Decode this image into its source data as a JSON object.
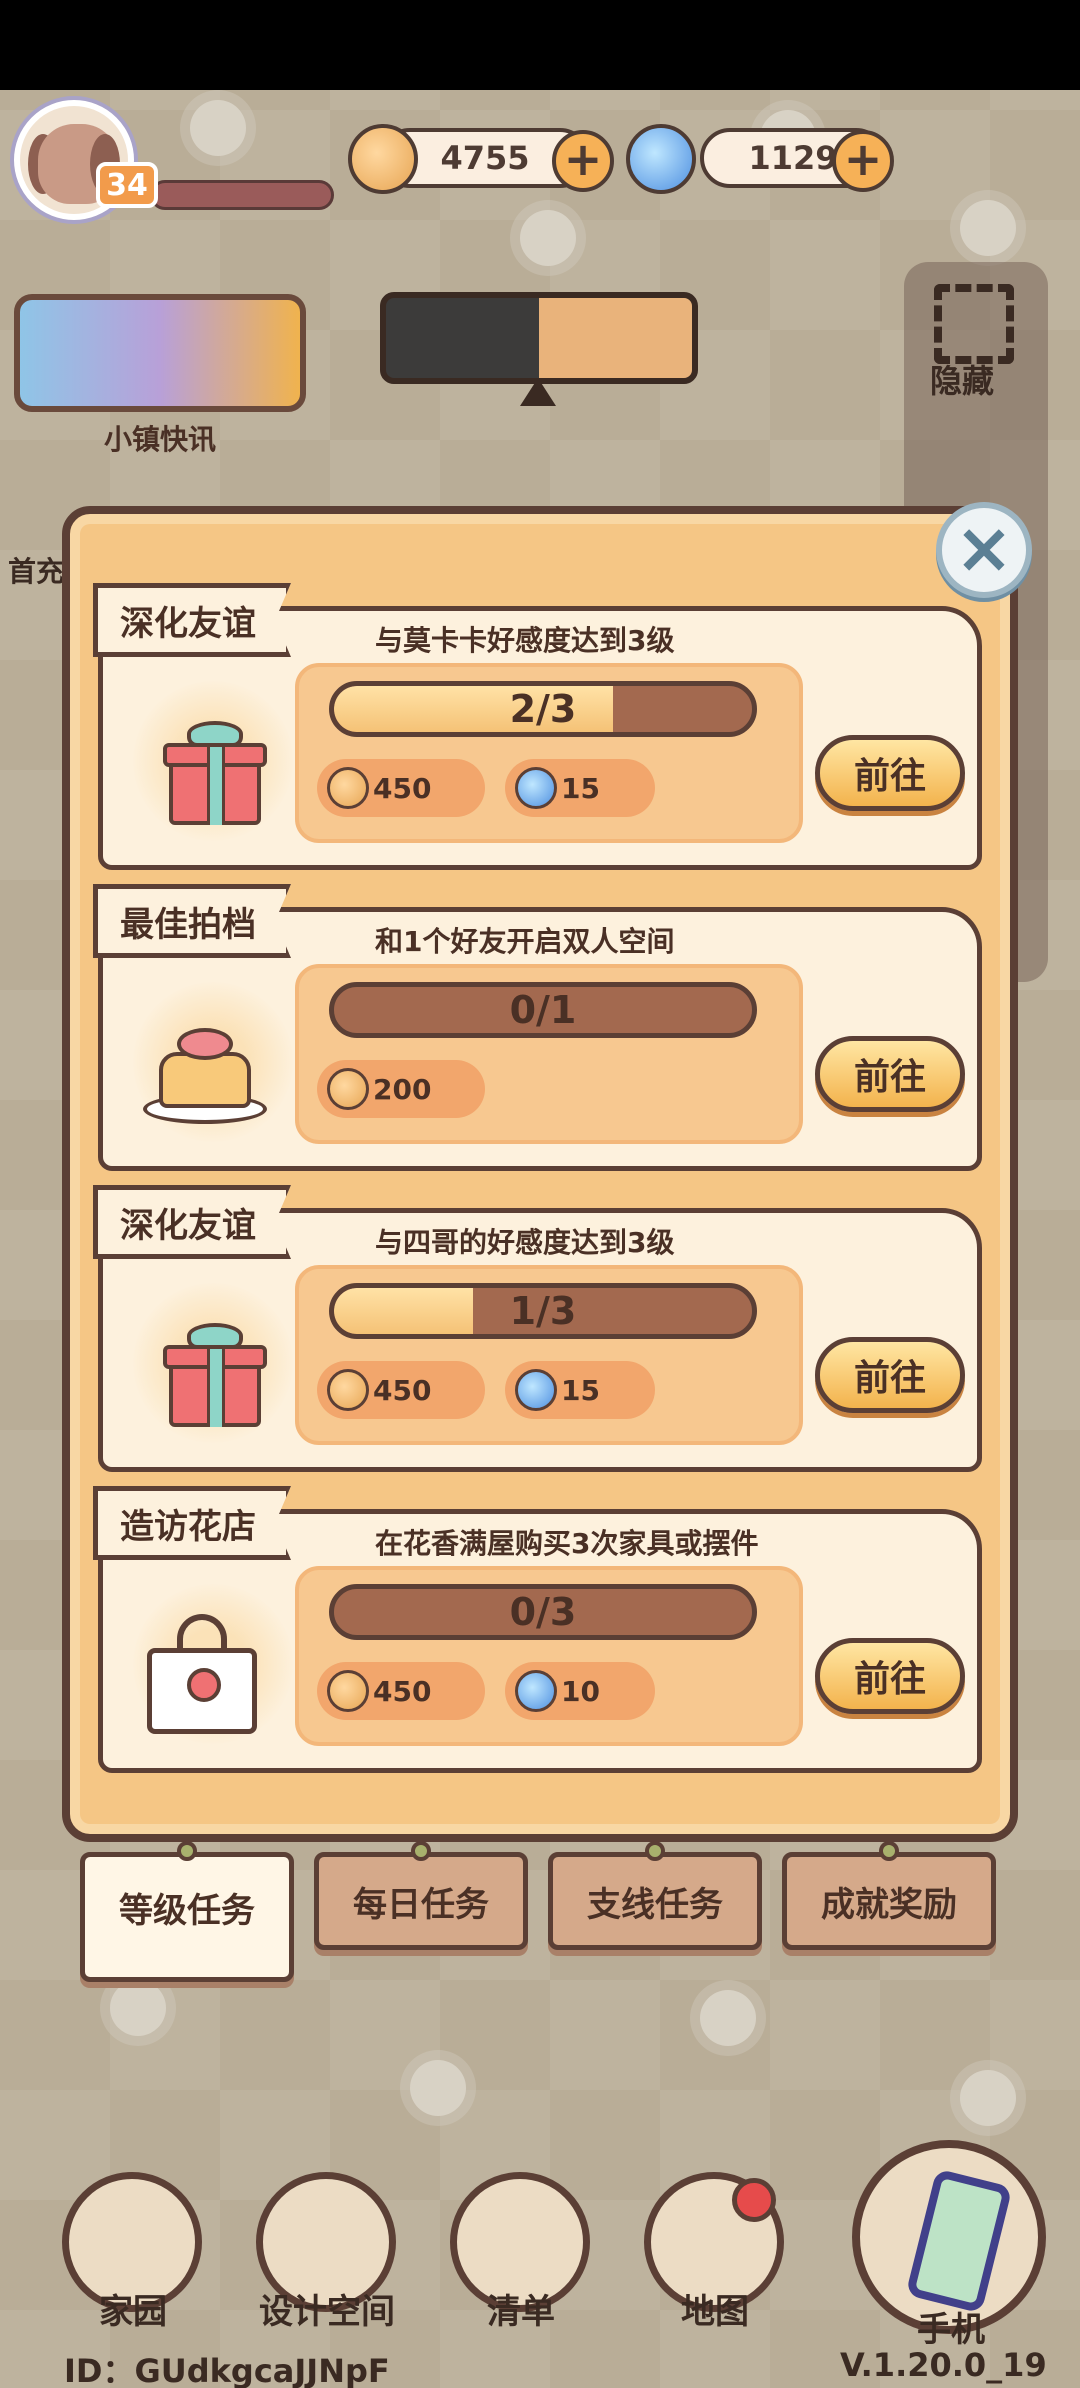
{
  "player": {
    "level": "34"
  },
  "currency": {
    "coins": "4755",
    "gems": "1129"
  },
  "news": {
    "label": "小镇快讯"
  },
  "side": {
    "hide_label": "隐藏",
    "first_charge_label": "首充"
  },
  "tasks": [
    {
      "title": "深化友谊",
      "desc": "与莫卡卡好感度达到3级",
      "progress_text": "2/3",
      "progress": 0.667,
      "icon": "gift-icon",
      "rewards": [
        {
          "icon": "coin-icon",
          "amount": "450"
        },
        {
          "icon": "gem-icon",
          "amount": "15"
        }
      ],
      "go_label": "前往"
    },
    {
      "title": "最佳拍档",
      "desc": "和1个好友开启双人空间",
      "progress_text": "0/1",
      "progress": 0.0,
      "icon": "cake-icon",
      "rewards": [
        {
          "icon": "coin-icon",
          "amount": "200"
        }
      ],
      "go_label": "前往"
    },
    {
      "title": "深化友谊",
      "desc": "与四哥的好感度达到3级",
      "progress_text": "1/3",
      "progress": 0.333,
      "icon": "gift-icon",
      "rewards": [
        {
          "icon": "coin-icon",
          "amount": "450"
        },
        {
          "icon": "gem-icon",
          "amount": "15"
        }
      ],
      "go_label": "前往"
    },
    {
      "title": "造访花店",
      "desc": "在花香满屋购买3次家具或摆件",
      "progress_text": "0/3",
      "progress": 0.0,
      "icon": "flower-bag-icon",
      "rewards": [
        {
          "icon": "coin-icon",
          "amount": "450"
        },
        {
          "icon": "gem-icon",
          "amount": "10"
        }
      ],
      "go_label": "前往"
    }
  ],
  "tabs": [
    {
      "label": "等级任务",
      "active": true
    },
    {
      "label": "每日任务",
      "active": false
    },
    {
      "label": "支线任务",
      "active": false
    },
    {
      "label": "成就奖励",
      "active": false
    }
  ],
  "nav": [
    {
      "label": "家园",
      "icon": "home-icon"
    },
    {
      "label": "设计空间",
      "icon": "design-icon"
    },
    {
      "label": "清单",
      "icon": "list-icon"
    },
    {
      "label": "地图",
      "icon": "map-icon"
    },
    {
      "label": "手机",
      "icon": "phone-icon"
    }
  ],
  "footer": {
    "id": "ID：GUdkgcaJJNpF",
    "version": "V.1.20.0_19"
  },
  "colors": {
    "panel": "#f5c685",
    "card": "#fdf1dd",
    "border": "#5b3f35",
    "progress_fill": "#f5c276",
    "progress_track": "#a3694f"
  }
}
